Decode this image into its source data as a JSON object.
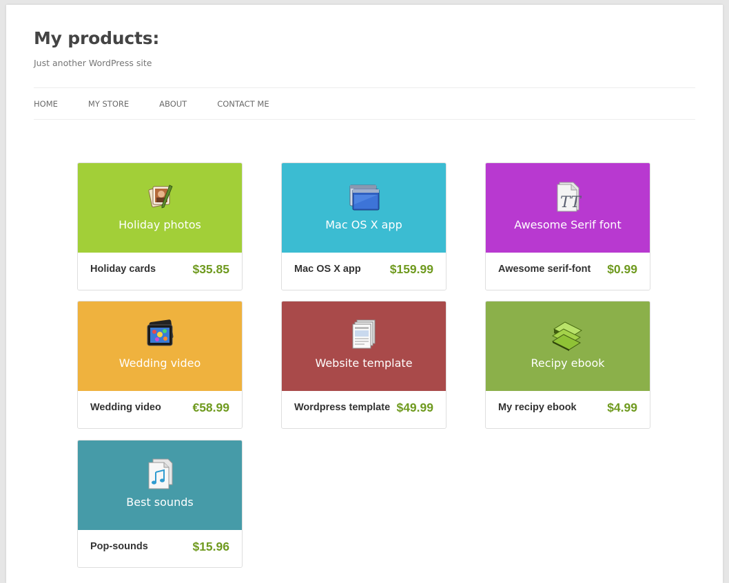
{
  "site": {
    "title": "My products:",
    "description": "Just another WordPress site"
  },
  "nav": [
    {
      "label": "HOME"
    },
    {
      "label": "MY STORE"
    },
    {
      "label": "ABOUT"
    },
    {
      "label": "CONTACT ME"
    }
  ],
  "products": [
    {
      "banner_title": "Holiday photos",
      "name": "Holiday cards",
      "price": "$35.85",
      "color": "#a2cf38",
      "icon": "photos-icon"
    },
    {
      "banner_title": "Mac OS X app",
      "name": "Mac OS X app",
      "price": "$159.99",
      "color": "#3bbcd2",
      "icon": "app-window-icon"
    },
    {
      "banner_title": "Awesome Serif font",
      "name": "Awesome serif-font",
      "price": "$0.99",
      "color": "#b839d0",
      "icon": "font-file-icon"
    },
    {
      "banner_title": "Wedding video",
      "name": "Wedding video",
      "price": "€58.99",
      "color": "#efb23e",
      "icon": "video-film-icon"
    },
    {
      "banner_title": "Website template",
      "name": "Wordpress template",
      "price": "$49.99",
      "color": "#a94a4a",
      "icon": "template-document-icon"
    },
    {
      "banner_title": "Recipy ebook",
      "name": "My recipy ebook",
      "price": "$4.99",
      "color": "#8bb04a",
      "icon": "ebook-stack-icon"
    },
    {
      "banner_title": "Best sounds",
      "name": "Pop-sounds",
      "price": "$15.96",
      "color": "#469ba8",
      "icon": "music-file-icon"
    }
  ]
}
